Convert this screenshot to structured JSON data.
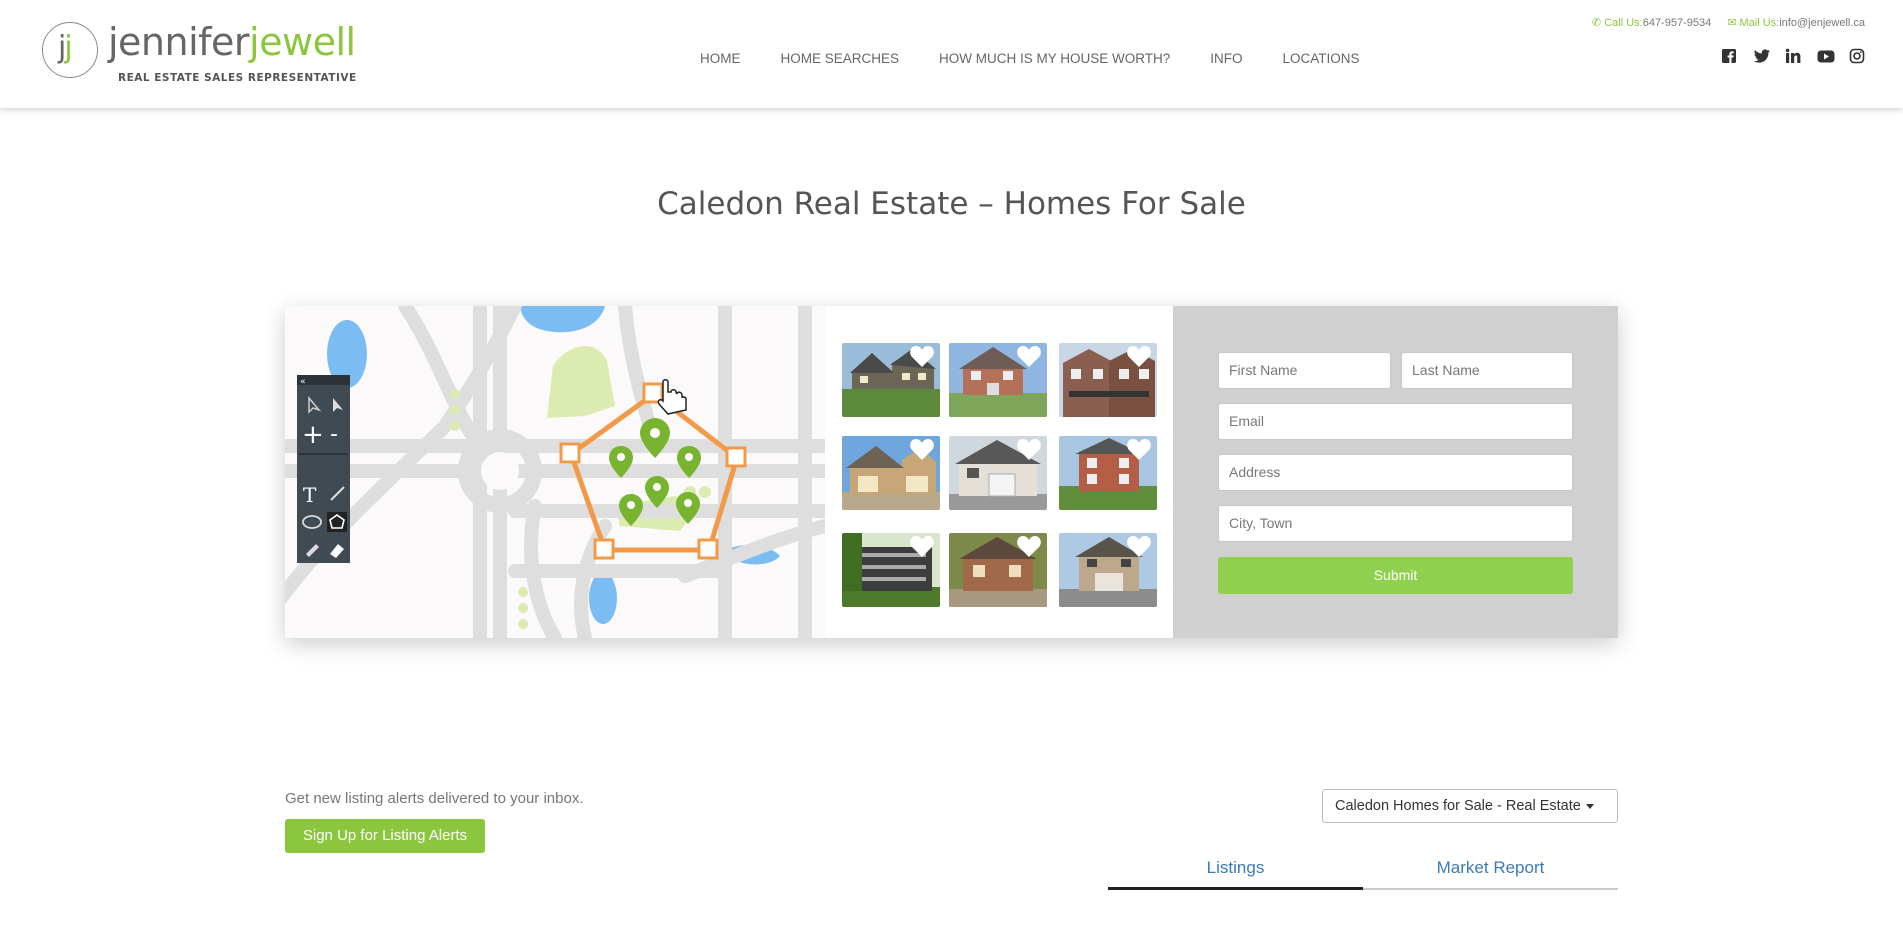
{
  "header": {
    "logo": {
      "initials": "jj",
      "name_first": "jennifer",
      "name_second": "jewell",
      "tagline": "REAL ESTATE SALES REPRESENTATIVE"
    },
    "nav": [
      {
        "label": "HOME"
      },
      {
        "label": "HOME SEARCHES"
      },
      {
        "label": "HOW MUCH IS MY HOUSE WORTH?"
      },
      {
        "label": "INFO"
      },
      {
        "label": "LOCATIONS"
      }
    ],
    "contact": {
      "call_label": "Call Us:",
      "call_value": "647-957-9534",
      "mail_label": "Mail Us:",
      "mail_value": "info@jenjewell.ca"
    },
    "social": [
      "facebook-icon",
      "twitter-icon",
      "linkedin-icon",
      "youtube-icon",
      "instagram-icon"
    ]
  },
  "page_title": "Caledon Real Estate – Homes For Sale",
  "form": {
    "first_name_placeholder": "First Name",
    "last_name_placeholder": "Last Name",
    "email_placeholder": "Email",
    "address_placeholder": "Address",
    "city_placeholder": "City, Town",
    "submit_label": "Submit"
  },
  "alerts": {
    "text": "Get new listing alerts delivered to your inbox.",
    "button_label": "Sign Up for Listing Alerts"
  },
  "dropdown": {
    "selected": "Caledon Homes for Sale - Real Estate"
  },
  "tabs": [
    {
      "label": "Listings",
      "active": true
    },
    {
      "label": "Market Report",
      "active": false
    }
  ],
  "colors": {
    "brand_green": "#8cc63f",
    "link_blue": "#3d7ab8",
    "map_orange": "#f39a4a"
  }
}
